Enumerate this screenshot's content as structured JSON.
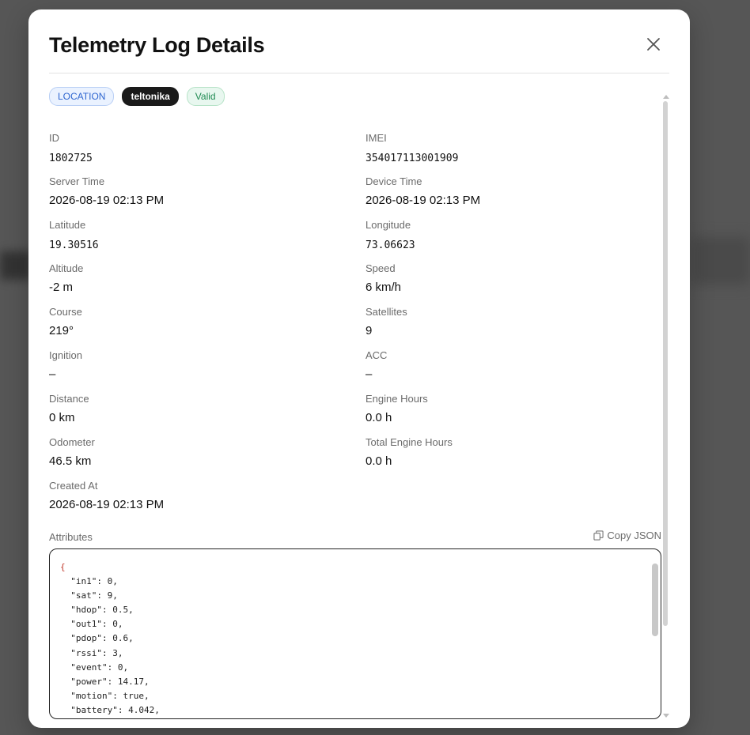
{
  "modal": {
    "title": "Telemetry Log Details"
  },
  "badges": {
    "type": "LOCATION",
    "vendor": "teltonika",
    "validity": "Valid"
  },
  "fields": {
    "id": {
      "label": "ID",
      "value": "1802725"
    },
    "imei": {
      "label": "IMEI",
      "value": "354017113001909"
    },
    "server_time": {
      "label": "Server Time",
      "value": "2026-08-19 02:13 PM"
    },
    "device_time": {
      "label": "Device Time",
      "value": "2026-08-19 02:13 PM"
    },
    "latitude": {
      "label": "Latitude",
      "value": "19.30516"
    },
    "longitude": {
      "label": "Longitude",
      "value": "73.06623"
    },
    "altitude": {
      "label": "Altitude",
      "value": "-2 m"
    },
    "speed": {
      "label": "Speed",
      "value": "6 km/h"
    },
    "course": {
      "label": "Course",
      "value": "219°"
    },
    "satellites": {
      "label": "Satellites",
      "value": "9"
    },
    "ignition": {
      "label": "Ignition",
      "value": "–"
    },
    "acc": {
      "label": "ACC",
      "value": "–"
    },
    "distance": {
      "label": "Distance",
      "value": "0 km"
    },
    "engine_hours": {
      "label": "Engine Hours",
      "value": "0.0 h"
    },
    "odometer": {
      "label": "Odometer",
      "value": "46.5 km"
    },
    "total_engine_hours": {
      "label": "Total Engine Hours",
      "value": "0.0 h"
    },
    "created_at": {
      "label": "Created At",
      "value": "2026-08-19 02:13 PM"
    }
  },
  "attributes": {
    "label": "Attributes",
    "copy_label": "Copy JSON",
    "open_brace": "{",
    "lines": [
      "  \"in1\": 0,",
      "  \"sat\": 9,",
      "  \"hdop\": 0.5,",
      "  \"out1\": 0,",
      "  \"pdop\": 0.6,",
      "  \"rssi\": 3,",
      "  \"event\": 0,",
      "  \"power\": 14.17,",
      "  \"motion\": true,",
      "  \"battery\": 4.042,"
    ]
  },
  "icons": {
    "close": "close-icon",
    "copy": "copy-icon"
  },
  "colors": {
    "location_badge": "#2f66d0",
    "vendor_badge_bg": "#1a1a1a",
    "valid_badge": "#1f8a52"
  }
}
